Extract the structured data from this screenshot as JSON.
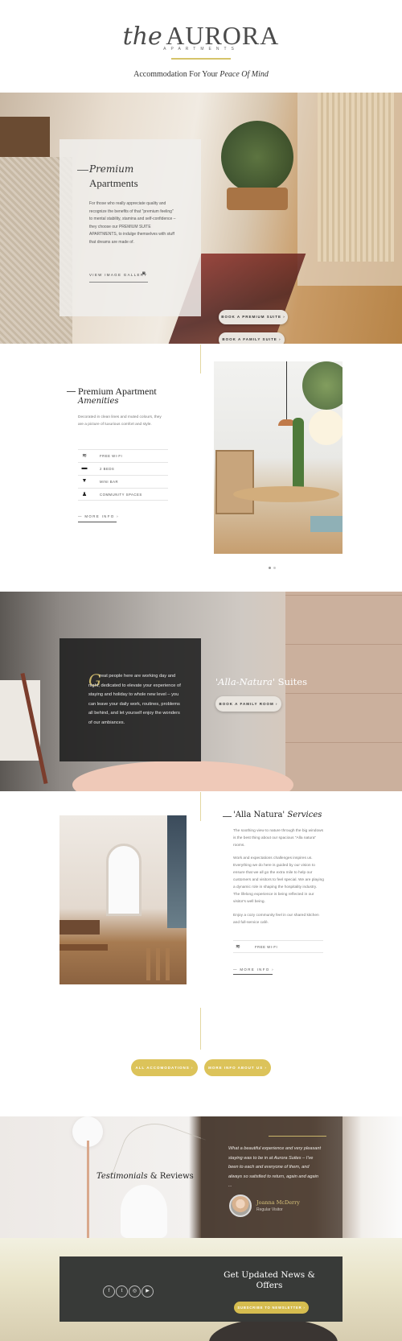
{
  "header": {
    "logo_the": "the",
    "logo_aurora": "AURORA",
    "logo_sub": "APARTMENTS",
    "tagline_prefix": "Accommodation For Your ",
    "tagline_italic": "Peace Of Mind"
  },
  "hero": {
    "title_italic": "Premium",
    "title": "Apartments",
    "text": "For those who really appreciate quality and recognize the benefits of that \"premium feeling\" to mental stability, stamina and self-confidence – they choose our PREMIUM SUITE APARTMENTS, to indulge themselves with stuff that dreams are made of.",
    "gallery_label": "VIEW IMAGE GALLERY",
    "gallery_icon": "camera-icon",
    "btn_premium": "BOOK A PREMIUM SUITE",
    "btn_family": "BOOK A FAMILY SUITE",
    "btn_arrow": "›"
  },
  "amenities": {
    "title": "Premium Apartment",
    "title_italic": "Amenities",
    "description": "Decorated in clean lines and muted colours, they are a picture of luxurious comfort and style.",
    "items": [
      {
        "icon": "wifi-icon",
        "glyph": "≋",
        "label": "FREE WI-FI"
      },
      {
        "icon": "bed-icon",
        "glyph": "▬",
        "label": "2 BEDS"
      },
      {
        "icon": "cocktail-icon",
        "glyph": "▼",
        "label": "MINI BAR"
      },
      {
        "icon": "person-icon",
        "glyph": "♟",
        "label": "COMMUNITY SPACES"
      }
    ],
    "more_label": "— MORE INFO  ›"
  },
  "bath": {
    "initial": "G",
    "text": "reat people here are working day and night, dedicated to elevate your experience of staying and holiday to whole new level – you can leave your daily work, routines, problems all behind, and let yourself enjoy the wonders of our ambiances.",
    "title_italic": "'Alla-Natura'",
    "title_rest": " Suites",
    "btn_family": "BOOK A FAMILY ROOM  ›"
  },
  "alla": {
    "title_prefix": "'Alla Natura' ",
    "title_italic": "Services",
    "p1": "The soothing view to nature through the big windows is the best thing about our spacious \"Alla natura\" rooms.",
    "p2": "Work and expectations challenges inspires us. Everything we do here is guided by our vision to ensure that we all go the extra mile to help our customers and visitors to feel special. We are playing a dynamic role in shaping the hospitality industry. The lifelong experience is being reflected in our visitor's well being.",
    "p3": "Enjoy a cozy community feel in our shared kitchen and full-service café.",
    "wifi_label": "FREE WI-FI",
    "more_label": "— MORE INFO  ›"
  },
  "cta": {
    "all_label": "ALL ACCOMODATIONS  ›",
    "about_label": "MORE INFO ABOUT US  ›"
  },
  "testimonials": {
    "title_italic": "Testimonials",
    "amp": " & ",
    "title_rest": "Reviews",
    "quote": "What a beautiful experience and very pleasant staying was to be in at Aurora Suites – I've been to each and everyone of them, and always so satisfied to return, again and again ...",
    "name": "Joanna McDerry",
    "role": "Regular Visitor"
  },
  "newsletter": {
    "title": "Get Updated News & Offers",
    "social": [
      {
        "icon": "facebook-icon",
        "glyph": "f"
      },
      {
        "icon": "twitter-icon",
        "glyph": "t"
      },
      {
        "icon": "instagram-icon",
        "glyph": "◎"
      },
      {
        "icon": "youtube-icon",
        "glyph": "▶"
      }
    ],
    "subscribe_label": "SUBSCRIBE TO NEWSLETTER  ›"
  },
  "colors": {
    "accent_gold": "#dcc35a",
    "dark_card": "#383a38"
  }
}
